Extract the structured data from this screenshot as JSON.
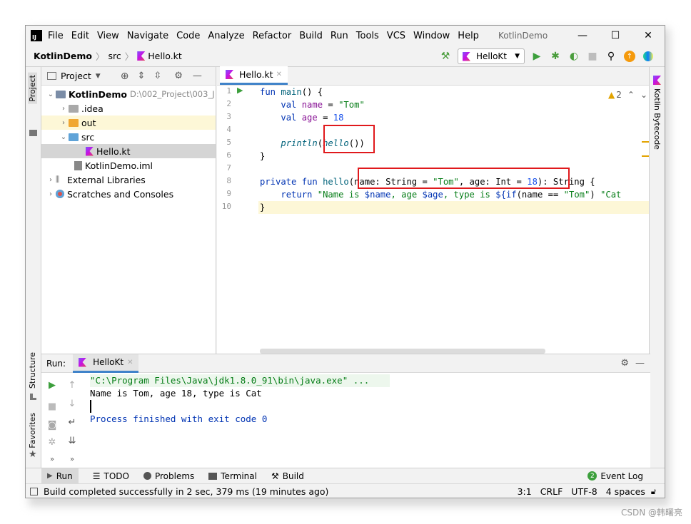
{
  "app": {
    "title": "KotlinDemo",
    "logo": "IJ"
  },
  "menu": [
    "File",
    "Edit",
    "View",
    "Navigate",
    "Code",
    "Analyze",
    "Refactor",
    "Build",
    "Run",
    "Tools",
    "VCS",
    "Window",
    "Help"
  ],
  "window_controls": {
    "minimize": "—",
    "maximize": "☐",
    "close": "✕"
  },
  "breadcrumb": {
    "project": "KotlinDemo",
    "folder": "src",
    "file": "Hello.kt"
  },
  "run_config": {
    "name": "HelloKt"
  },
  "sidebar_tabs": {
    "project": "Project",
    "structure": "Structure",
    "favorites": "Favorites",
    "kotlin_bytecode": "Kotlin Bytecode"
  },
  "project_panel": {
    "title": "Project",
    "tree": [
      {
        "label": "KotlinDemo",
        "extra": "D:\\002_Project\\003_J",
        "bold": true
      },
      {
        "label": ".idea"
      },
      {
        "label": "out"
      },
      {
        "label": "src"
      },
      {
        "label": "Hello.kt"
      },
      {
        "label": "KotlinDemo.iml"
      },
      {
        "label": "External Libraries"
      },
      {
        "label": "Scratches and Consoles"
      }
    ]
  },
  "editor": {
    "tab": "Hello.kt",
    "warnings": "2",
    "line_numbers": [
      "1",
      "2",
      "3",
      "4",
      "5",
      "6",
      "7",
      "8",
      "9",
      "10"
    ]
  },
  "run_panel": {
    "label": "Run:",
    "tab": "HelloKt",
    "console": [
      "\"C:\\Program Files\\Java\\jdk1.8.0_91\\bin\\java.exe\" ...",
      "Name is Tom, age 18, type is Cat",
      "",
      "Process finished with exit code 0"
    ]
  },
  "bottom_tools": {
    "run": "Run",
    "todo": "TODO",
    "problems": "Problems",
    "terminal": "Terminal",
    "build": "Build",
    "event_log": "Event Log",
    "event_count": "2"
  },
  "status": {
    "message": "Build completed successfully in 2 sec, 379 ms (19 minutes ago)",
    "position": "3:1",
    "line_sep": "CRLF",
    "encoding": "UTF-8",
    "indent": "4 spaces"
  },
  "watermark": "CSDN @韩曙亮",
  "colors": {
    "accent": "#4083c9",
    "highlight_box": "#e0191c",
    "keyword": "#0033b3",
    "string": "#067d17",
    "number": "#1750eb"
  }
}
